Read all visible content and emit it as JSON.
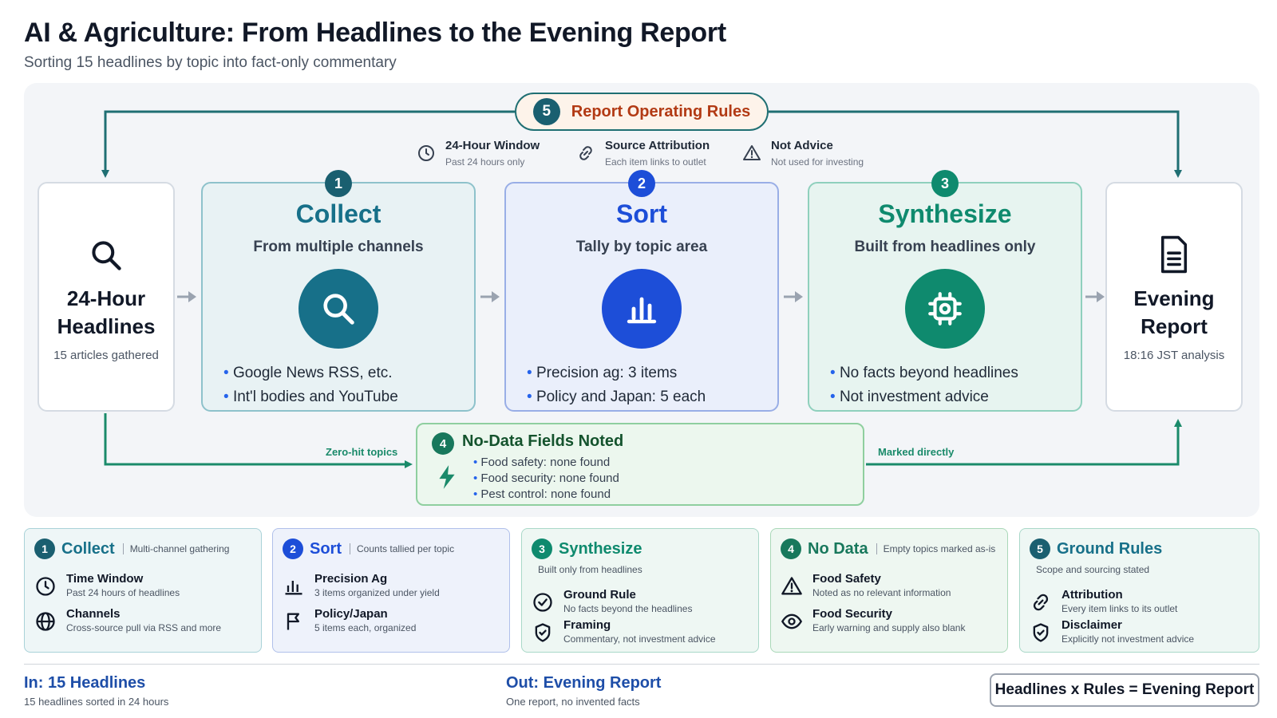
{
  "title": "AI & Agriculture: From Headlines to the Evening Report",
  "subtitle": "Sorting 15 headlines by topic into fact-only commentary",
  "rules": {
    "num": "5",
    "label": "Report Operating Rules",
    "items": [
      {
        "title": "24-Hour Window",
        "desc": "Past 24 hours only",
        "icon": "clock-icon"
      },
      {
        "title": "Source Attribution",
        "desc": "Each item links to outlet",
        "icon": "link-icon"
      },
      {
        "title": "Not Advice",
        "desc": "Not used for investing",
        "icon": "warning-icon"
      }
    ]
  },
  "input": {
    "line1": "24-Hour",
    "line2": "Headlines",
    "desc": "15 articles gathered"
  },
  "output": {
    "line1": "Evening",
    "line2": "Report",
    "desc": "18:16 JST analysis"
  },
  "stages": [
    {
      "num": "1",
      "name": "Collect",
      "desc": "From multiple channels",
      "bullets": [
        "Google News RSS, etc.",
        "Int'l bodies and YouTube"
      ],
      "color": "#177089",
      "bg": "#e8f2f4",
      "border": "#8ec2cb"
    },
    {
      "num": "2",
      "name": "Sort",
      "desc": "Tally by topic area",
      "bullets": [
        "Precision ag: 3 items",
        "Policy and Japan: 5 each"
      ],
      "color": "#1d4ed8",
      "bg": "#eaeffb",
      "border": "#99aee6"
    },
    {
      "num": "3",
      "name": "Synthesize",
      "desc": "Built from headlines only",
      "bullets": [
        "No facts beyond headlines",
        "Not investment advice"
      ],
      "color": "#0f8a6e",
      "bg": "#e7f4f0",
      "border": "#8fd0bd"
    }
  ],
  "nodata": {
    "num": "4",
    "title": "No-Data Fields Noted",
    "items": [
      "Food safety: none found",
      "Food security: none found",
      "Pest control: none found"
    ],
    "left_label": "Zero-hit topics",
    "right_label": "Marked directly"
  },
  "cards": [
    {
      "num": "1",
      "title": "Collect",
      "sub": "Multi-channel gathering",
      "rows": [
        {
          "t": "Time Window",
          "d": "Past 24 hours of headlines"
        },
        {
          "t": "Channels",
          "d": "Cross-source pull via RSS and more"
        }
      ]
    },
    {
      "num": "2",
      "title": "Sort",
      "sub": "Counts tallied per topic",
      "rows": [
        {
          "t": "Precision Ag",
          "d": "3 items organized under yield"
        },
        {
          "t": "Policy/Japan",
          "d": "5 items each, organized"
        }
      ]
    },
    {
      "num": "3",
      "title": "Synthesize",
      "sub": "Built only from headlines",
      "rows": [
        {
          "t": "Ground Rule",
          "d": "No facts beyond the headlines"
        },
        {
          "t": "Framing",
          "d": "Commentary, not investment advice"
        }
      ]
    },
    {
      "num": "4",
      "title": "No Data",
      "sub": "Empty topics marked as-is",
      "rows": [
        {
          "t": "Food Safety",
          "d": "Noted as no relevant information"
        },
        {
          "t": "Food Security",
          "d": "Early warning and supply also blank"
        }
      ]
    },
    {
      "num": "5",
      "title": "Ground Rules",
      "sub": "Scope and sourcing stated",
      "rows": [
        {
          "t": "Attribution",
          "d": "Every item links to its outlet"
        },
        {
          "t": "Disclaimer",
          "d": "Explicitly not investment advice"
        }
      ]
    }
  ],
  "footer": {
    "in_title": "In: 15 Headlines",
    "in_desc": "15 headlines sorted in 24 hours",
    "out_title": "Out: Evening Report",
    "out_desc": "One report, no invented facts",
    "equation": "Headlines x Rules = Evening Report"
  }
}
